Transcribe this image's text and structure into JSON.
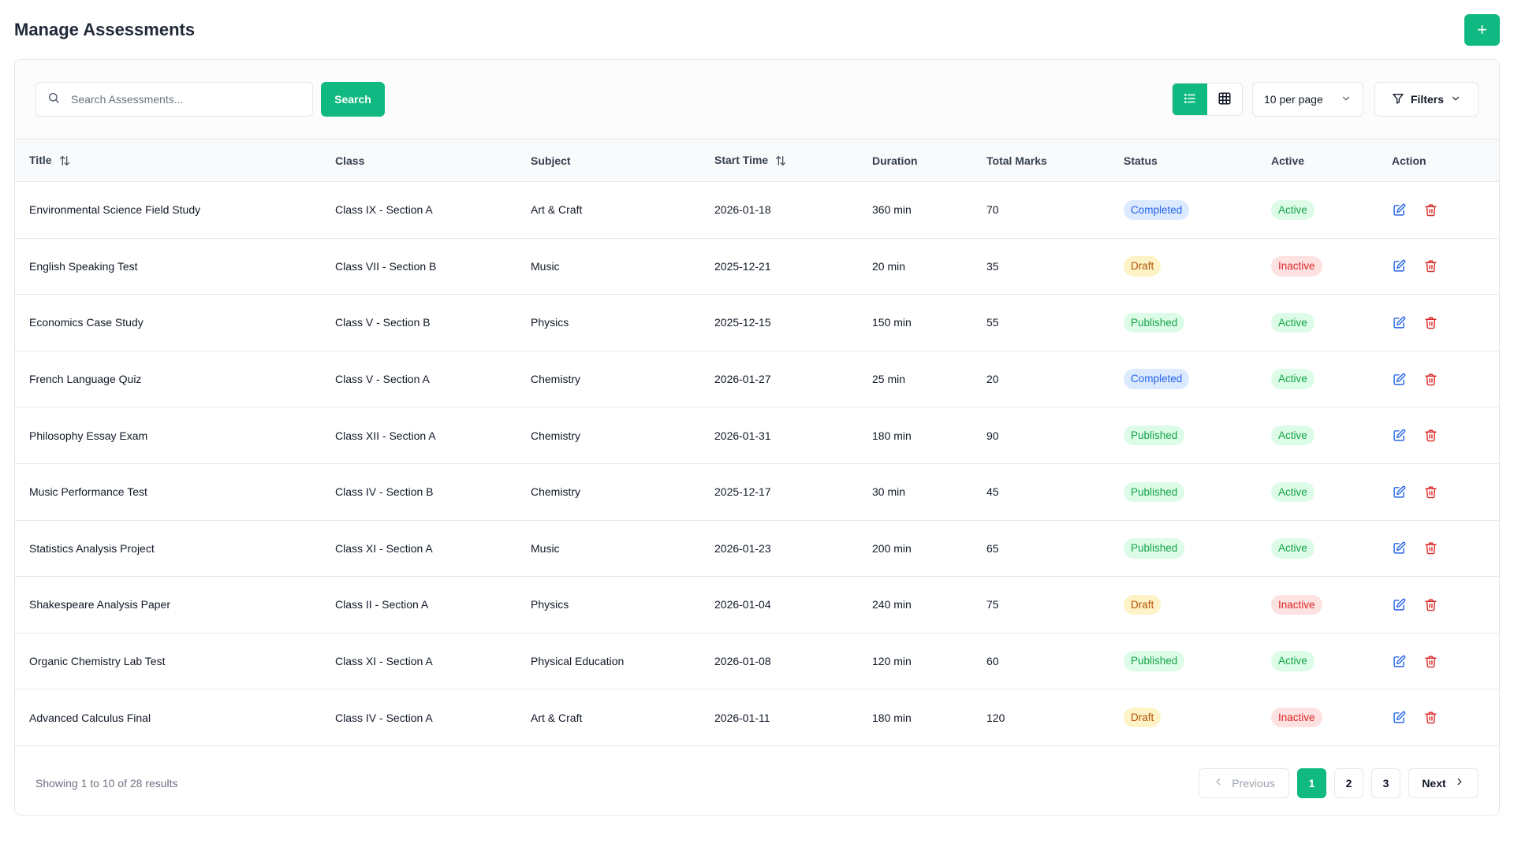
{
  "header": {
    "title": "Manage Assessments",
    "add_label": "+"
  },
  "toolbar": {
    "search_placeholder": "Search Assessments...",
    "search_label": "Search",
    "per_page": "10 per page",
    "filters_label": "Filters"
  },
  "table": {
    "columns": [
      "Title",
      "Class",
      "Subject",
      "Start Time",
      "Duration",
      "Total Marks",
      "Status",
      "Active",
      "Action"
    ],
    "rows": [
      {
        "title": "Environmental Science Field Study",
        "class": "Class IX - Section A",
        "subject": "Art & Craft",
        "start": "2026-01-18",
        "duration": "360 min",
        "marks": "70",
        "status": "Completed",
        "active": "Active"
      },
      {
        "title": "English Speaking Test",
        "class": "Class VII - Section B",
        "subject": "Music",
        "start": "2025-12-21",
        "duration": "20 min",
        "marks": "35",
        "status": "Draft",
        "active": "Inactive"
      },
      {
        "title": "Economics Case Study",
        "class": "Class V - Section B",
        "subject": "Physics",
        "start": "2025-12-15",
        "duration": "150 min",
        "marks": "55",
        "status": "Published",
        "active": "Active"
      },
      {
        "title": "French Language Quiz",
        "class": "Class V - Section A",
        "subject": "Chemistry",
        "start": "2026-01-27",
        "duration": "25 min",
        "marks": "20",
        "status": "Completed",
        "active": "Active"
      },
      {
        "title": "Philosophy Essay Exam",
        "class": "Class XII - Section A",
        "subject": "Chemistry",
        "start": "2026-01-31",
        "duration": "180 min",
        "marks": "90",
        "status": "Published",
        "active": "Active"
      },
      {
        "title": "Music Performance Test",
        "class": "Class IV - Section B",
        "subject": "Chemistry",
        "start": "2025-12-17",
        "duration": "30 min",
        "marks": "45",
        "status": "Published",
        "active": "Active"
      },
      {
        "title": "Statistics Analysis Project",
        "class": "Class XI - Section A",
        "subject": "Music",
        "start": "2026-01-23",
        "duration": "200 min",
        "marks": "65",
        "status": "Published",
        "active": "Active"
      },
      {
        "title": "Shakespeare Analysis Paper",
        "class": "Class II - Section A",
        "subject": "Physics",
        "start": "2026-01-04",
        "duration": "240 min",
        "marks": "75",
        "status": "Draft",
        "active": "Inactive"
      },
      {
        "title": "Organic Chemistry Lab Test",
        "class": "Class XI - Section A",
        "subject": "Physical Education",
        "start": "2026-01-08",
        "duration": "120 min",
        "marks": "60",
        "status": "Published",
        "active": "Active"
      },
      {
        "title": "Advanced Calculus Final",
        "class": "Class IV - Section A",
        "subject": "Art & Craft",
        "start": "2026-01-11",
        "duration": "180 min",
        "marks": "120",
        "status": "Draft",
        "active": "Inactive"
      }
    ]
  },
  "footer": {
    "showing": "Showing 1 to 10 of 28 results",
    "prev_label": "Previous",
    "next_label": "Next",
    "pages": [
      "1",
      "2",
      "3"
    ],
    "current_page": "1"
  },
  "colors": {
    "accent": "#10b981",
    "edit": "#2563eb",
    "delete": "#dc2626"
  },
  "icons": {
    "search": "search-icon",
    "list": "list-view-icon",
    "grid": "grid-view-icon",
    "chevron": "chevron-down-icon",
    "filter": "filter-icon",
    "sort": "sort-icon",
    "edit": "edit-icon",
    "delete": "trash-icon"
  }
}
